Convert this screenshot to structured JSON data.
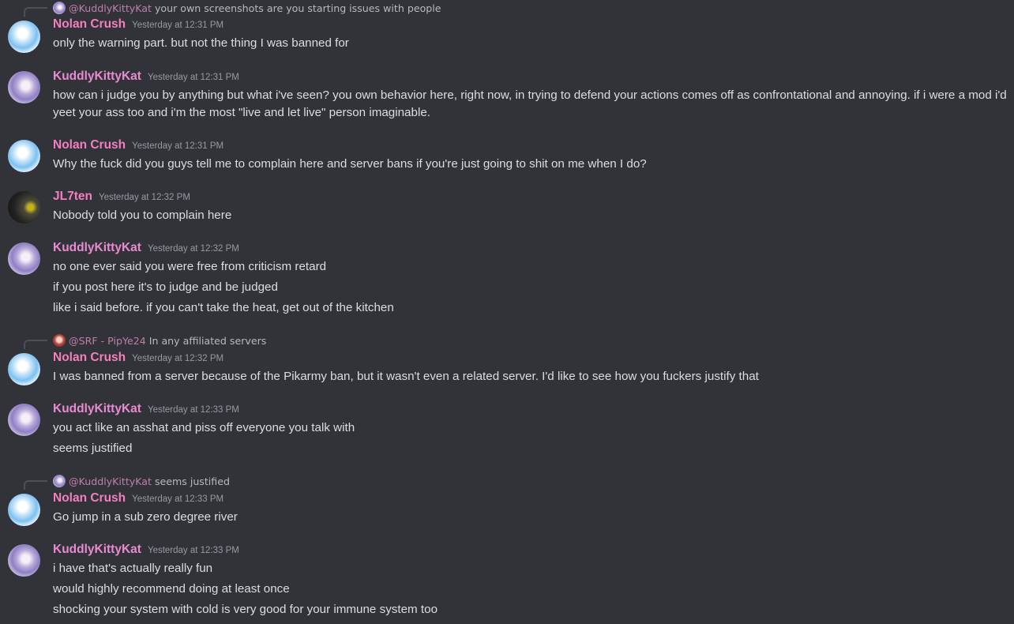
{
  "messages": [
    {
      "reply": {
        "author": "@KuddlyKittyKat",
        "text": "your own screenshots are you starting issues with people"
      },
      "author": "Nolan Crush",
      "timestamp": "Yesterday at 12:31 PM",
      "lines": [
        "only the warning part. but not the thing I was banned for"
      ]
    },
    {
      "author": "KuddlyKittyKat",
      "timestamp": "Yesterday at 12:31 PM",
      "lines": [
        "how can i judge you by anything but what i've seen? you own behavior here, right now, in trying to defend your actions comes off as confrontational and annoying. if i were a mod i'd",
        "yeet your ass too and i'm the most \"live and let live\" person imaginable."
      ]
    },
    {
      "author": "Nolan Crush",
      "timestamp": "Yesterday at 12:31 PM",
      "lines": [
        "Why the fuck did you guys tell me to complain here and server bans if you're just going to shit on me when I do?"
      ]
    },
    {
      "author": "JL7ten",
      "timestamp": "Yesterday at 12:32 PM",
      "lines": [
        "Nobody told you to complain here"
      ]
    },
    {
      "author": "KuddlyKittyKat",
      "timestamp": "Yesterday at 12:32 PM",
      "lines": [
        "no one ever said you were free from criticism retard",
        "if you post here it's to judge and be judged",
        "like i said before. if you can't take the heat, get out of the kitchen"
      ]
    },
    {
      "reply": {
        "author": "@SRF - PipYe24",
        "text": "In any affiliated servers"
      },
      "author": "Nolan Crush",
      "timestamp": "Yesterday at 12:32 PM",
      "lines": [
        "I was banned from a server because of the Pikarmy ban, but it wasn't even a related server. I'd like to see how you fuckers justify that"
      ]
    },
    {
      "author": "KuddlyKittyKat",
      "timestamp": "Yesterday at 12:33 PM",
      "lines": [
        "you act like an asshat and piss off everyone you talk with",
        "seems justified"
      ]
    },
    {
      "reply": {
        "author": "@KuddlyKittyKat",
        "text": "seems justified"
      },
      "author": "Nolan Crush",
      "timestamp": "Yesterday at 12:33 PM",
      "lines": [
        "Go jump in a sub zero degree river"
      ]
    },
    {
      "author": "KuddlyKittyKat",
      "timestamp": "Yesterday at 12:33 PM",
      "lines": [
        "i have that's actually really fun",
        "would highly recommend doing at least once",
        "shocking your system with cold is very good for your immune system too"
      ]
    }
  ],
  "colors": {
    "background": "#313338",
    "text": "#dbdee1",
    "timestamp": "#949ba4",
    "username_nolan": "#f47fbf",
    "username_kitty": "#e98bd1",
    "reply_author": "#c07fa8"
  }
}
